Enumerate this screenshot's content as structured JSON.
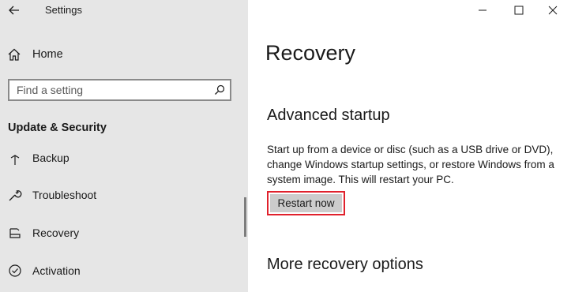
{
  "app": {
    "title": "Settings"
  },
  "sidebar": {
    "home_label": "Home",
    "search_placeholder": "Find a setting",
    "section_title": "Update & Security",
    "items": [
      {
        "label": "Backup",
        "icon": "backup-icon"
      },
      {
        "label": "Troubleshoot",
        "icon": "wrench-icon"
      },
      {
        "label": "Recovery",
        "icon": "recovery-icon"
      },
      {
        "label": "Activation",
        "icon": "activation-icon"
      }
    ]
  },
  "main": {
    "title": "Recovery",
    "advanced_startup": {
      "heading": "Advanced startup",
      "description": "Start up from a device or disc (such as a USB drive or DVD), change Windows startup settings, or restore Windows from a system image. This will restart your PC.",
      "button_label": "Restart now"
    },
    "more_options_heading": "More recovery options"
  },
  "colors": {
    "sidebar_bg": "#e6e6e6",
    "button_bg": "#cccccc",
    "highlight_outline": "#e0212c"
  }
}
